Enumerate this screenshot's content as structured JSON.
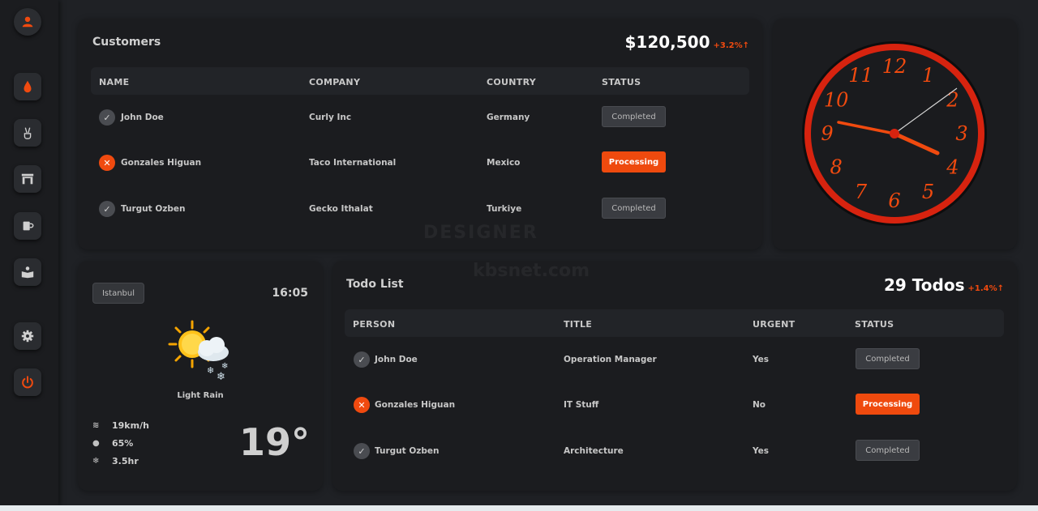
{
  "sidebar": {
    "items": [
      {
        "icon": "user-icon"
      },
      {
        "icon": "drop-icon"
      },
      {
        "icon": "peace-hand-icon"
      },
      {
        "icon": "gate-icon"
      },
      {
        "icon": "mug-icon"
      },
      {
        "icon": "reader-icon"
      },
      {
        "icon": "gear-icon"
      },
      {
        "icon": "power-icon"
      }
    ]
  },
  "customers": {
    "title": "Customers",
    "total": "$120,500",
    "delta": "+3.2%↑",
    "columns": [
      "NAME",
      "COMPANY",
      "COUNTRY",
      "STATUS"
    ],
    "rows": [
      {
        "name": "John Doe",
        "company": "Curly Inc",
        "country": "Germany",
        "status": "Completed",
        "state": "ok"
      },
      {
        "name": "Gonzales Higuan",
        "company": "Taco International",
        "country": "Mexico",
        "status": "Processing",
        "state": "x"
      },
      {
        "name": "Turgut Ozben",
        "company": "Gecko Ithalat",
        "country": "Turkiye",
        "status": "Completed",
        "state": "ok"
      }
    ]
  },
  "clock": {
    "numerals": [
      "12",
      "1",
      "2",
      "3",
      "4",
      "5",
      "6",
      "7",
      "8",
      "9",
      "10",
      "11"
    ],
    "accent": "#f04a0f"
  },
  "weather": {
    "city": "Istanbul",
    "time": "16:05",
    "condition": "Light Rain",
    "wind": "19km/h",
    "humidity": "65%",
    "sun": "3.5hr",
    "temperature": "19°"
  },
  "todo": {
    "title": "Todo List",
    "count": "29 Todos",
    "delta": "+1.4%↑",
    "columns": [
      "PERSON",
      "TITLE",
      "URGENT",
      "STATUS"
    ],
    "rows": [
      {
        "person": "John Doe",
        "title": "Operation Manager",
        "urgent": "Yes",
        "status": "Completed",
        "state": "ok"
      },
      {
        "person": "Gonzales Higuan",
        "title": "IT Stuff",
        "urgent": "No",
        "status": "Processing",
        "state": "x"
      },
      {
        "person": "Turgut Ozben",
        "title": "Architecture",
        "urgent": "Yes",
        "status": "Completed",
        "state": "ok"
      }
    ]
  },
  "watermark": {
    "line1": "DESIGNER",
    "line2": "kbsnet.com"
  },
  "colors": {
    "accent": "#f04a0f",
    "background": "#1f2125",
    "card": "#1b1c1f"
  }
}
